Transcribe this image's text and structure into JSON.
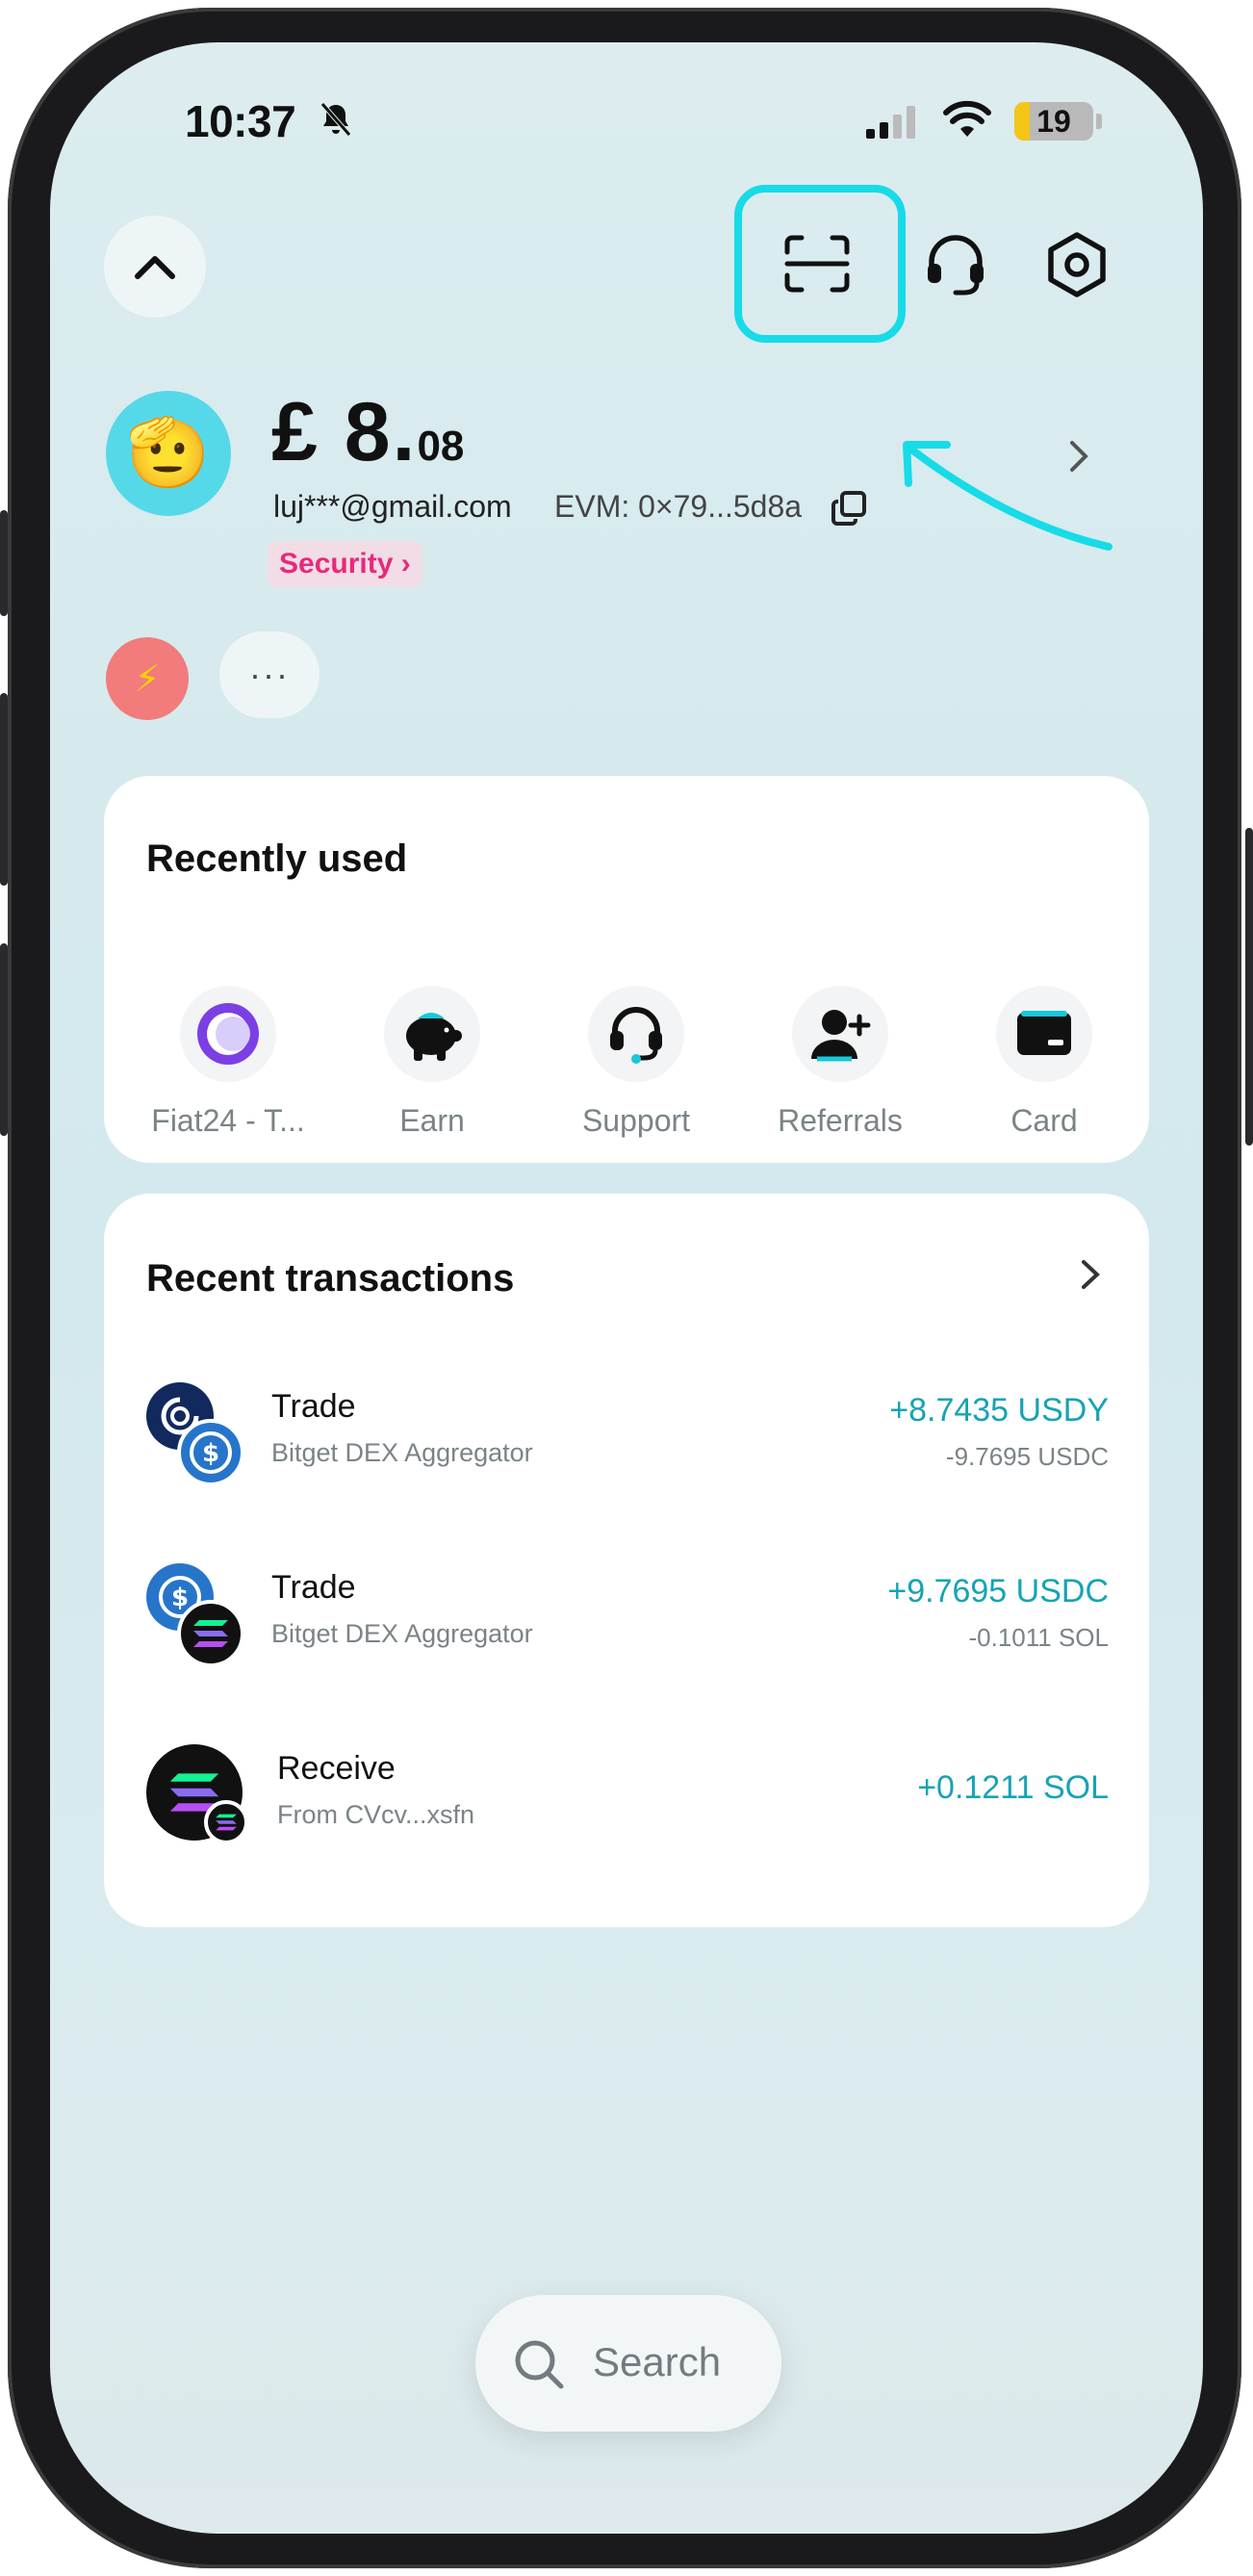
{
  "status_bar": {
    "time": "10:37",
    "battery_level": "19",
    "battery_fraction": 0.19
  },
  "colors": {
    "accent_cyan": "#18dbe8",
    "amount_teal": "#16a3b5",
    "security_pink": "#e8297a"
  },
  "header": {
    "collapse_icon": "chevron-up-icon",
    "scan_icon": "scan-icon",
    "support_icon": "headset-icon",
    "settings_icon": "settings-icon"
  },
  "account": {
    "avatar_emoji": "🫡",
    "balance_main": "£ 8.",
    "balance_cents": "08",
    "email": "luj***@gmail.com",
    "evm_address": "EVM: 0×79...5d8a",
    "security_label": "Security"
  },
  "quick_actions": {
    "bolt_icon": "lightning-icon",
    "more_label": "···"
  },
  "recently_used": {
    "title": "Recently used",
    "items": [
      {
        "label": "Fiat24 - T...",
        "icon": "fiat24-icon"
      },
      {
        "label": "Earn",
        "icon": "piggy-bank-icon"
      },
      {
        "label": "Support",
        "icon": "headset-icon"
      },
      {
        "label": "Referrals",
        "icon": "add-user-icon"
      },
      {
        "label": "Card",
        "icon": "card-icon"
      }
    ]
  },
  "recent_transactions": {
    "title": "Recent transactions",
    "items": [
      {
        "title": "Trade",
        "subtitle": "Bitget DEX Aggregator",
        "amount": "+8.7435 USDY",
        "secondary": "-9.7695 USDC"
      },
      {
        "title": "Trade",
        "subtitle": "Bitget DEX Aggregator",
        "amount": "+9.7695 USDC",
        "secondary": "-0.1011 SOL"
      },
      {
        "title": "Receive",
        "subtitle": "From CVcv...xsfn",
        "amount": "+0.1211 SOL",
        "secondary": ""
      }
    ]
  },
  "search": {
    "label": "Search"
  }
}
